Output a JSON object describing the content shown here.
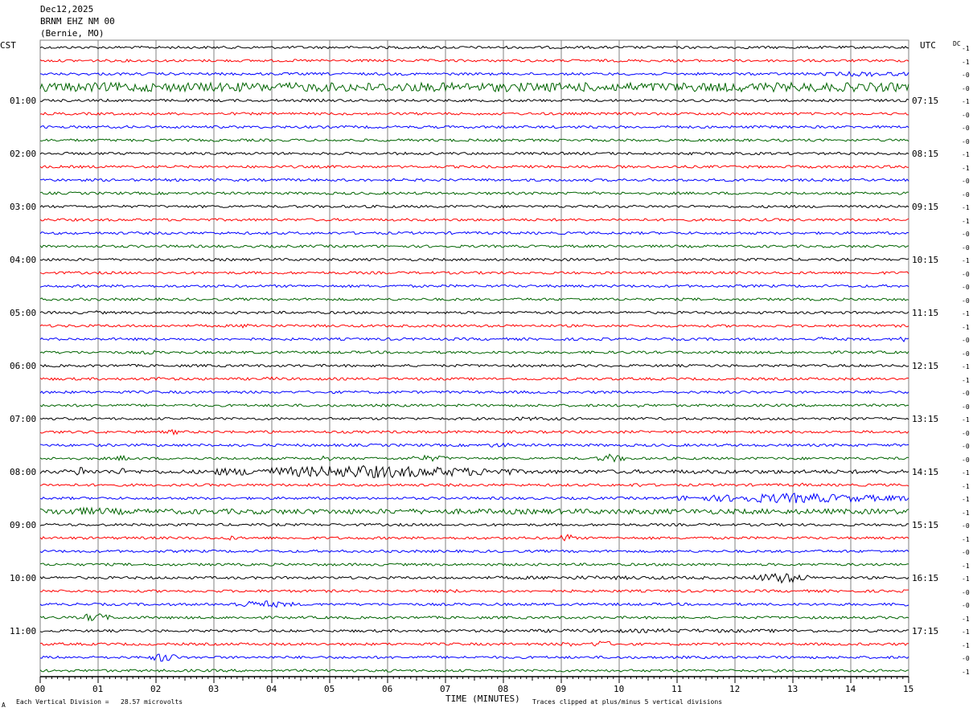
{
  "header": {
    "date": "Dec12,2025",
    "station": "BRNM EHZ NM 00",
    "location": "(Bernie, MO)"
  },
  "left_axis_label": "CST",
  "right_axis_label": "UTC",
  "dc_label": "DC",
  "footer": {
    "scale_note": "Each Vertical Division =   28.57 microvolts",
    "clip_note": "Traces clipped at plus/minus 5 vertical divisions",
    "corner_mark": "A"
  },
  "colors": {
    "c0": "#000000",
    "c1": "#ff0000",
    "c2": "#0000ff",
    "c3": "#006400",
    "grid": "#808080"
  },
  "chart_data": {
    "type": "line",
    "title": "",
    "xlabel": "TIME (MINUTES)",
    "xlim": [
      0,
      15
    ],
    "x_ticks": [
      "00",
      "01",
      "02",
      "03",
      "04",
      "05",
      "06",
      "07",
      "08",
      "09",
      "10",
      "11",
      "12",
      "13",
      "14",
      "15"
    ],
    "trace_count": 48,
    "trace_minutes": 15,
    "left_labels": [
      {
        "trace": 4,
        "text": "01:00"
      },
      {
        "trace": 8,
        "text": "02:00"
      },
      {
        "trace": 12,
        "text": "03:00"
      },
      {
        "trace": 16,
        "text": "04:00"
      },
      {
        "trace": 20,
        "text": "05:00"
      },
      {
        "trace": 24,
        "text": "06:00"
      },
      {
        "trace": 28,
        "text": "07:00"
      },
      {
        "trace": 32,
        "text": "08:00"
      },
      {
        "trace": 36,
        "text": "09:00"
      },
      {
        "trace": 40,
        "text": "10:00"
      },
      {
        "trace": 44,
        "text": "11:00"
      }
    ],
    "right_labels": [
      {
        "trace": 4,
        "text": "07:15"
      },
      {
        "trace": 8,
        "text": "08:15"
      },
      {
        "trace": 12,
        "text": "09:15"
      },
      {
        "trace": 16,
        "text": "10:15"
      },
      {
        "trace": 20,
        "text": "11:15"
      },
      {
        "trace": 24,
        "text": "12:15"
      },
      {
        "trace": 28,
        "text": "13:15"
      },
      {
        "trace": 32,
        "text": "14:15"
      },
      {
        "trace": 36,
        "text": "15:15"
      },
      {
        "trace": 40,
        "text": "16:15"
      },
      {
        "trace": 44,
        "text": "17:15"
      }
    ],
    "dc_offsets": [
      "-1",
      "-1",
      "-0",
      "-0",
      "-1",
      "-0",
      "-0",
      "-0",
      "-1",
      "-1",
      "-0",
      "-0",
      "-1",
      "-1",
      "-0",
      "-0",
      "-1",
      "-0",
      "-0",
      "-0",
      "-1",
      "-1",
      "-0",
      "-0",
      "-1",
      "-1",
      "-0",
      "-0",
      "-1",
      "-0",
      "-0",
      "-0",
      "-1",
      "-1",
      "-1",
      "-1",
      "-0",
      "-1",
      "-0",
      "-1",
      "-1",
      "-0",
      "-0",
      "-1",
      "-1",
      "-1",
      "-0",
      "-1"
    ],
    "trace_colors": [
      "c0",
      "c1",
      "c2",
      "c3"
    ],
    "trace_amplitude": [
      2,
      2,
      2,
      7,
      2,
      2,
      2,
      2,
      2,
      2,
      2,
      2,
      2,
      2,
      2,
      2,
      2,
      2,
      2,
      2,
      2,
      2,
      2,
      2,
      2,
      2,
      2,
      2,
      2,
      2,
      2,
      2,
      3,
      2,
      2,
      4,
      2,
      2,
      2,
      2,
      2,
      2,
      2,
      2,
      2,
      2,
      2,
      2
    ],
    "events": [
      {
        "trace": 2,
        "start": 13.5,
        "end": 15.0,
        "amp": 4
      },
      {
        "trace": 3,
        "start": 0.0,
        "end": 6.0,
        "amp": 6
      },
      {
        "trace": 20,
        "start": 0.8,
        "end": 1.1,
        "amp": 3
      },
      {
        "trace": 21,
        "start": 3.4,
        "end": 3.9,
        "amp": 4
      },
      {
        "trace": 22,
        "start": 13.4,
        "end": 13.6,
        "amp": 4
      },
      {
        "trace": 22,
        "start": 14.8,
        "end": 15.0,
        "amp": 5
      },
      {
        "trace": 23,
        "start": 1.8,
        "end": 2.0,
        "amp": 4
      },
      {
        "trace": 25,
        "start": 1.9,
        "end": 2.1,
        "amp": 4
      },
      {
        "trace": 25,
        "start": 3.9,
        "end": 4.1,
        "amp": 4
      },
      {
        "trace": 27,
        "start": 10.2,
        "end": 10.5,
        "amp": 3
      },
      {
        "trace": 28,
        "start": 8.0,
        "end": 9.0,
        "amp": 3
      },
      {
        "trace": 29,
        "start": 2.2,
        "end": 2.4,
        "amp": 5
      },
      {
        "trace": 29,
        "start": 3.6,
        "end": 4.0,
        "amp": 3
      },
      {
        "trace": 30,
        "start": 7.7,
        "end": 8.2,
        "amp": 4
      },
      {
        "trace": 31,
        "start": 1.3,
        "end": 1.6,
        "amp": 5
      },
      {
        "trace": 31,
        "start": 4.8,
        "end": 5.0,
        "amp": 6
      },
      {
        "trace": 31,
        "start": 6.3,
        "end": 7.1,
        "amp": 5
      },
      {
        "trace": 31,
        "start": 9.6,
        "end": 10.1,
        "amp": 7
      },
      {
        "trace": 32,
        "start": 0.6,
        "end": 0.8,
        "amp": 10
      },
      {
        "trace": 32,
        "start": 1.3,
        "end": 1.5,
        "amp": 6
      },
      {
        "trace": 32,
        "start": 3.0,
        "end": 8.2,
        "amp": 10
      },
      {
        "trace": 33,
        "start": 10.2,
        "end": 10.4,
        "amp": 4
      },
      {
        "trace": 33,
        "start": 13.0,
        "end": 13.3,
        "amp": 3
      },
      {
        "trace": 34,
        "start": 11.0,
        "end": 15.0,
        "amp": 8
      },
      {
        "trace": 35,
        "start": 0.0,
        "end": 1.5,
        "amp": 6
      },
      {
        "trace": 37,
        "start": 3.2,
        "end": 3.4,
        "amp": 4
      },
      {
        "trace": 37,
        "start": 9.0,
        "end": 9.2,
        "amp": 9
      },
      {
        "trace": 40,
        "start": 7.5,
        "end": 11.5,
        "amp": 3
      },
      {
        "trace": 40,
        "start": 12.3,
        "end": 13.3,
        "amp": 9
      },
      {
        "trace": 41,
        "start": 7.0,
        "end": 7.3,
        "amp": 3
      },
      {
        "trace": 42,
        "start": 3.2,
        "end": 4.4,
        "amp": 6
      },
      {
        "trace": 42,
        "start": 14.8,
        "end": 15.0,
        "amp": 4
      },
      {
        "trace": 43,
        "start": 0.7,
        "end": 1.2,
        "amp": 8
      },
      {
        "trace": 44,
        "start": 8.0,
        "end": 13.5,
        "amp": 3
      },
      {
        "trace": 45,
        "start": 9.0,
        "end": 9.2,
        "amp": 5
      },
      {
        "trace": 45,
        "start": 9.5,
        "end": 9.9,
        "amp": 6
      },
      {
        "trace": 46,
        "start": 1.9,
        "end": 2.4,
        "amp": 8
      }
    ]
  }
}
